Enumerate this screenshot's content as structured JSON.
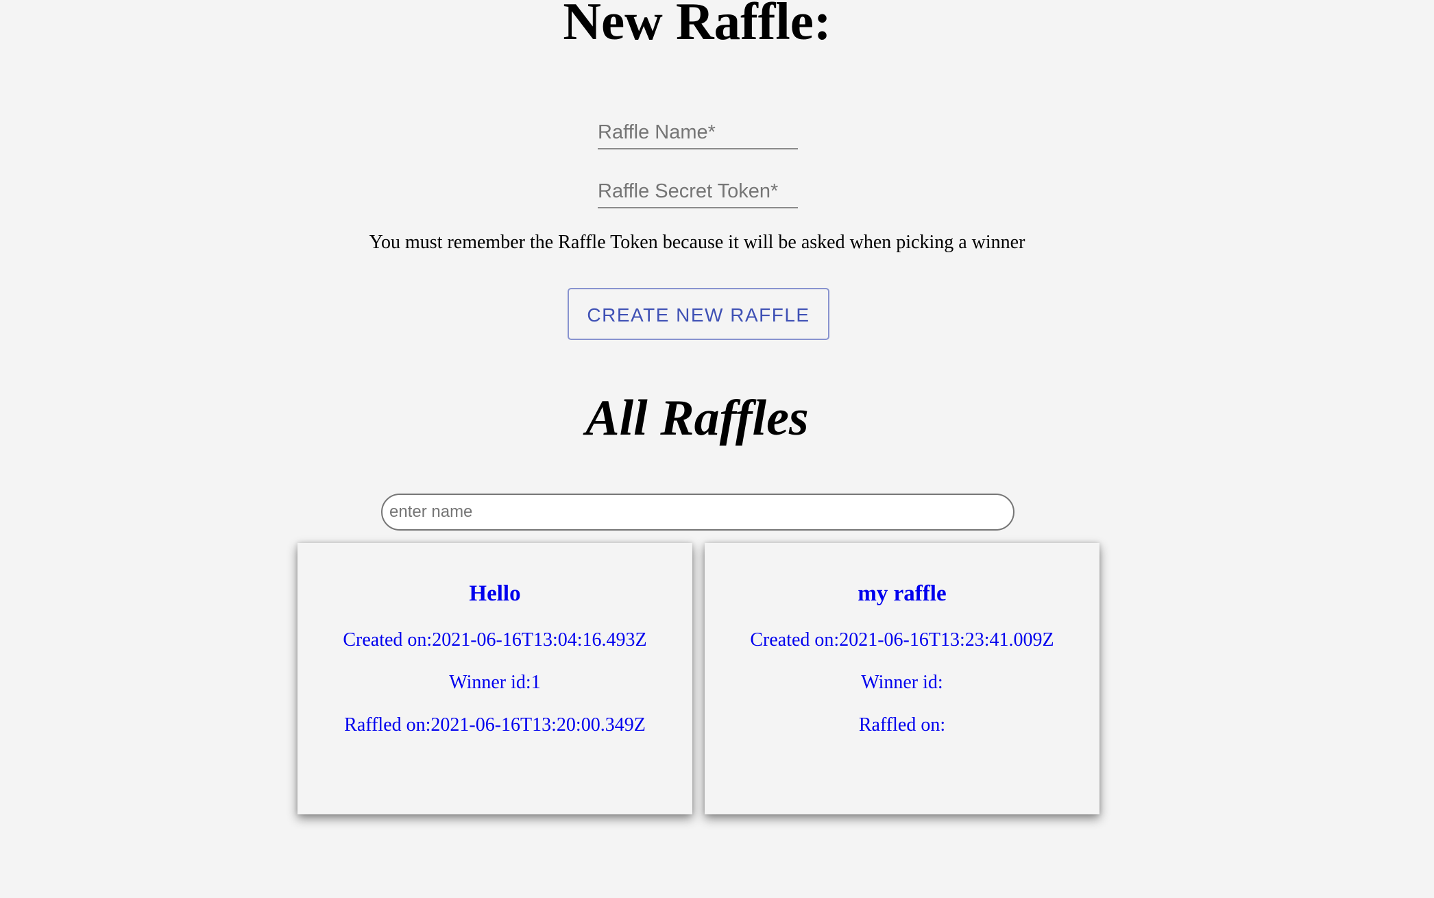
{
  "new_raffle": {
    "heading": "New Raffle:",
    "name_placeholder": "Raffle Name*",
    "token_placeholder": "Raffle Secret Token*",
    "notice": "You must remember the Raffle Token because it will be asked when picking a winner",
    "create_button_label": "CREATE NEW RAFFLE"
  },
  "all_raffles": {
    "heading": "All Raffles",
    "search_placeholder": "enter name",
    "cards": [
      {
        "title": "Hello",
        "created": "Created on:2021-06-16T13:04:16.493Z",
        "winner": "Winner id:1",
        "raffled": "Raffled on:2021-06-16T13:20:00.349Z"
      },
      {
        "title": "my raffle",
        "created": "Created on:2021-06-16T13:23:41.009Z",
        "winner": "Winner id:",
        "raffled": "Raffled on:"
      }
    ]
  },
  "colors": {
    "background": "#f4f4f4",
    "primary_button": "#3f51b5",
    "link_text": "#0000ee"
  }
}
